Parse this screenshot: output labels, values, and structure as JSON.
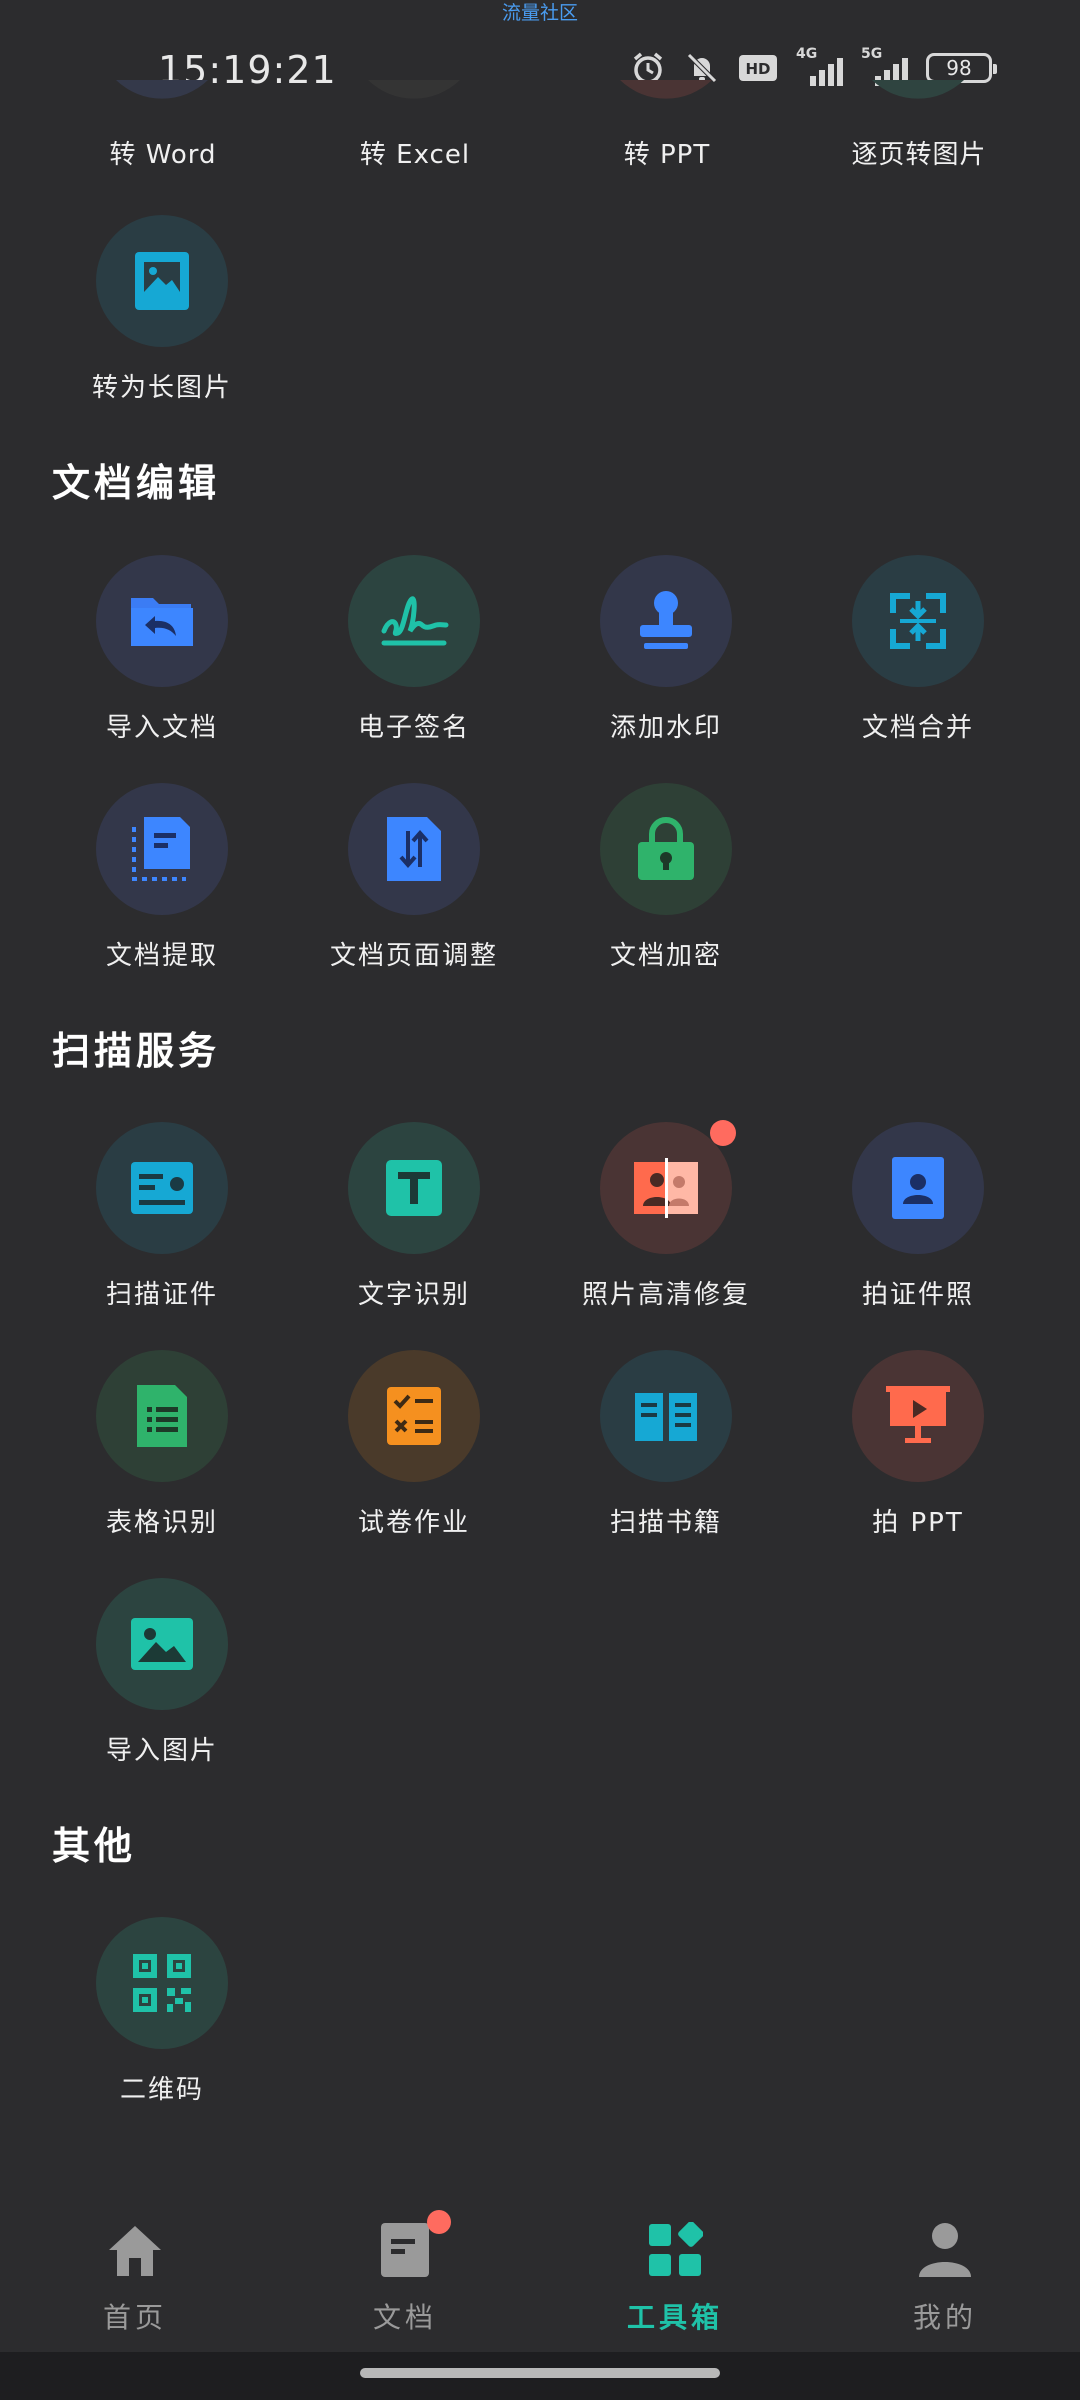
{
  "status_bar": {
    "top_label": "流量社区",
    "time": "15:19:21",
    "battery": "98",
    "network_1": "4G",
    "network_2": "5G"
  },
  "partial_row": [
    {
      "label": "转 Word",
      "icon": "word-icon"
    },
    {
      "label": "转 Excel",
      "icon": "excel-icon"
    },
    {
      "label": "转 PPT",
      "icon": "ppt-icon"
    },
    {
      "label": "逐页转图片",
      "icon": "page-to-image-icon"
    }
  ],
  "convert_more": [
    {
      "label": "转为长图片",
      "icon": "long-image-icon"
    }
  ],
  "sections": {
    "edit": {
      "title": "文档编辑",
      "items": [
        {
          "label": "导入文档",
          "icon": "import-folder-icon"
        },
        {
          "label": "电子签名",
          "icon": "signature-icon"
        },
        {
          "label": "添加水印",
          "icon": "stamp-icon"
        },
        {
          "label": "文档合并",
          "icon": "merge-icon"
        },
        {
          "label": "文档提取",
          "icon": "extract-icon"
        },
        {
          "label": "文档页面调整",
          "icon": "page-adjust-icon"
        },
        {
          "label": "文档加密",
          "icon": "lock-icon"
        }
      ]
    },
    "scan": {
      "title": "扫描服务",
      "items": [
        {
          "label": "扫描证件",
          "icon": "id-card-icon"
        },
        {
          "label": "文字识别",
          "icon": "text-recognition-icon"
        },
        {
          "label": "照片高清修复",
          "icon": "photo-restore-icon"
        },
        {
          "label": "拍证件照",
          "icon": "id-photo-icon"
        },
        {
          "label": "表格识别",
          "icon": "table-recognition-icon"
        },
        {
          "label": "试卷作业",
          "icon": "exam-icon"
        },
        {
          "label": "扫描书籍",
          "icon": "book-icon"
        },
        {
          "label": "拍 PPT",
          "icon": "presentation-icon"
        },
        {
          "label": "导入图片",
          "icon": "image-icon"
        }
      ]
    },
    "other": {
      "title": "其他",
      "items": [
        {
          "label": "二维码",
          "icon": "qr-code-icon"
        }
      ]
    }
  },
  "bottom_nav": [
    {
      "label": "首页",
      "icon": "home-icon"
    },
    {
      "label": "文档",
      "icon": "document-icon"
    },
    {
      "label": "工具箱",
      "icon": "toolbox-icon",
      "active": true
    },
    {
      "label": "我的",
      "icon": "profile-icon"
    }
  ],
  "colors": {
    "background": "#2c2c2e",
    "accent": "#1fc2a8",
    "badge": "#ff6b5f",
    "blue": "#3b7cf4",
    "cyan": "#16a8d4",
    "green": "#2fb36b",
    "orange": "#f5901f",
    "coral": "#ff6a4d"
  }
}
